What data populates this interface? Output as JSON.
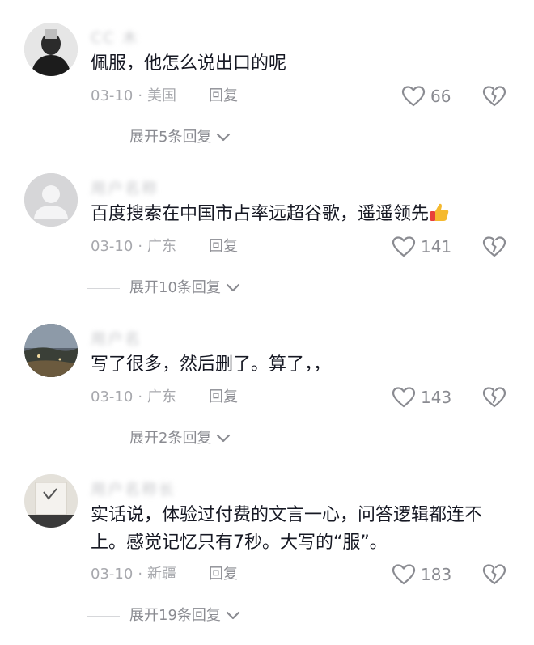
{
  "comments": [
    {
      "username": "CC 木",
      "text": "佩服，他怎么说出口的呢",
      "date": "03-10",
      "separator": "·",
      "location": "美国",
      "reply_label": "回复",
      "likes": "66",
      "expand_label": "展开5条回复"
    },
    {
      "username": "用户名称",
      "text": "百度搜索在中国市占率远超谷歌，遥遥领先",
      "date": "03-10",
      "separator": "·",
      "location": "广东",
      "reply_label": "回复",
      "likes": "141",
      "expand_label": "展开10条回复"
    },
    {
      "username": "用户名",
      "text": "写了很多，然后删了。算了，，",
      "date": "03-10",
      "separator": "·",
      "location": "广东",
      "reply_label": "回复",
      "likes": "143",
      "expand_label": "展开2条回复"
    },
    {
      "username": "用户名称长",
      "text": "实话说，体验过付费的文言一心，问答逻辑都连不上。感觉记忆只有7秒。大写的“服”。",
      "date": "03-10",
      "separator": "·",
      "location": "新疆",
      "reply_label": "回复",
      "likes": "183",
      "expand_label": "展开19条回复"
    }
  ],
  "colors": {
    "text": "#161823",
    "meta": "#a7a8ad",
    "action": "#8a8b91",
    "divider": "#d6d7da",
    "emoji_thumb": "#f5b92e",
    "emoji_cuff": "#e8413a"
  },
  "icons": [
    "heart-icon",
    "broken-heart-icon",
    "chevron-down-icon",
    "thumbs-up-emoji"
  ]
}
